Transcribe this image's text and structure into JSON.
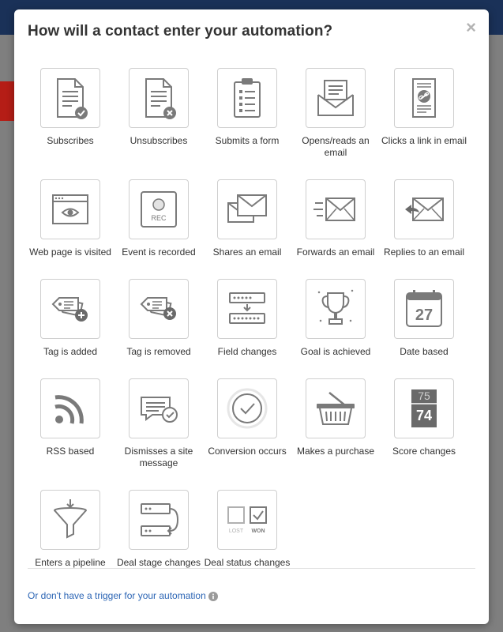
{
  "modal": {
    "title": "How will a contact enter your automation?",
    "close_symbol": "×"
  },
  "triggers": [
    {
      "label": "Subscribes",
      "icon": "document-check-icon"
    },
    {
      "label": "Unsubscribes",
      "icon": "document-x-icon"
    },
    {
      "label": "Submits a form",
      "icon": "clipboard-form-icon"
    },
    {
      "label": "Opens/reads an email",
      "icon": "open-envelope-icon"
    },
    {
      "label": "Clicks a link in email",
      "icon": "document-link-icon"
    },
    {
      "label": "Web page is visited",
      "icon": "browser-eye-icon"
    },
    {
      "label": "Event is recorded",
      "icon": "rec-button-icon",
      "icon_text": "REC"
    },
    {
      "label": "Shares an email",
      "icon": "stacked-envelopes-icon"
    },
    {
      "label": "Forwards an email",
      "icon": "fast-envelope-icon"
    },
    {
      "label": "Replies to an email",
      "icon": "reply-envelope-icon"
    },
    {
      "label": "Tag is added",
      "icon": "tag-plus-icon"
    },
    {
      "label": "Tag is removed",
      "icon": "tag-x-icon"
    },
    {
      "label": "Field changes",
      "icon": "field-arrow-icon"
    },
    {
      "label": "Goal is achieved",
      "icon": "trophy-icon"
    },
    {
      "label": "Date based",
      "icon": "calendar-icon",
      "icon_text": "27"
    },
    {
      "label": "RSS based",
      "icon": "rss-icon"
    },
    {
      "label": "Dismisses a site message",
      "icon": "chat-check-icon"
    },
    {
      "label": "Conversion occurs",
      "icon": "circle-check-icon"
    },
    {
      "label": "Makes a purchase",
      "icon": "basket-icon"
    },
    {
      "label": "Score changes",
      "icon": "score-counter-icon",
      "icon_text_top": "75",
      "icon_text": "74"
    },
    {
      "label": "Enters a pipeline",
      "icon": "funnel-icon"
    },
    {
      "label": "Deal stage changes",
      "icon": "stage-swap-icon"
    },
    {
      "label": "Deal status changes",
      "icon": "lost-won-icon",
      "icon_text_lost": "LOST",
      "icon_text_won": "WON"
    }
  ],
  "footer": {
    "link_text": "Or don't have a trigger for your automation",
    "info_icon": "info-icon"
  },
  "colors": {
    "icon_gray": "#7a7a7a",
    "link_blue": "#2d66b5",
    "tile_border": "#cfcfcf"
  }
}
